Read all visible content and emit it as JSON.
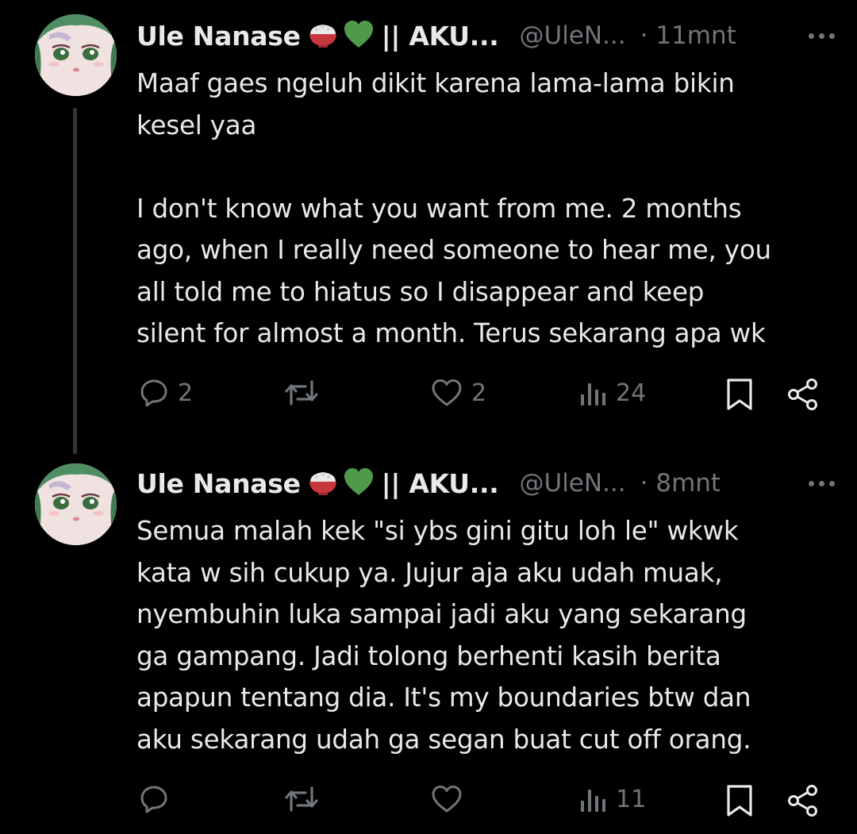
{
  "tweets": [
    {
      "display_name": "Ule Nanase",
      "name_suffix": "|| AKU...",
      "handle": "@UleN...",
      "time": "· 11mnt",
      "text": "Maaf gaes ngeluh dikit karena lama-lama bikin\nkesel yaa\n\nI don't know what you want from me. 2 months\nago, when I really need someone to hear me, you\nall told me to hiatus so I disappear and keep\nsilent for almost a month. Terus sekarang apa wk",
      "replies": "2",
      "likes": "2",
      "views": "24"
    },
    {
      "display_name": "Ule Nanase",
      "name_suffix": "|| AKU...",
      "handle": "@UleN...",
      "time": "· 8mnt",
      "text": "Semua malah kek \"si ybs gini gitu loh le\" wkwk\nkata w sih cukup ya. Jujur aja aku udah muak,\nnyembuhin luka sampai jadi aku yang sekarang\nga gampang. Jadi tolong berhenti kasih berita\napapun tentang dia. It's my boundaries btw dan\naku sekarang udah ga segan buat cut off orang.",
      "replies": "",
      "likes": "",
      "views": "11"
    }
  ],
  "icons": {
    "emoji_1": "rice-bowl-icon",
    "emoji_2": "green-heart-icon",
    "reply": "reply-icon",
    "retweet": "retweet-icon",
    "like": "heart-icon",
    "views": "views-icon",
    "bookmark": "bookmark-icon",
    "share": "share-icon"
  },
  "colors": {
    "background": "#000000",
    "text": "#e7e9ea",
    "muted": "#71767b",
    "thread_line": "#333639",
    "green_heart": "#4e9a4a"
  }
}
